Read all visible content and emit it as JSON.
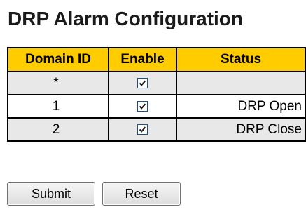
{
  "page": {
    "title": "DRP Alarm Configuration"
  },
  "table": {
    "headers": {
      "domain_id": "Domain ID",
      "enable": "Enable",
      "status": "Status"
    },
    "rows": [
      {
        "domain_id": "*",
        "enable": true,
        "status": ""
      },
      {
        "domain_id": "1",
        "enable": true,
        "status": "DRP Open"
      },
      {
        "domain_id": "2",
        "enable": true,
        "status": "DRP Close"
      }
    ]
  },
  "buttons": {
    "submit_label": "Submit",
    "reset_label": "Reset"
  },
  "colors": {
    "header_bg": "#ffcc00",
    "row_alt_bg": "#e8e8e8",
    "checkbox_border": "#1c5180",
    "checkmark": "#1a1a1a"
  },
  "icons": {
    "checkbox_checked": "checkbox-checked-icon"
  }
}
